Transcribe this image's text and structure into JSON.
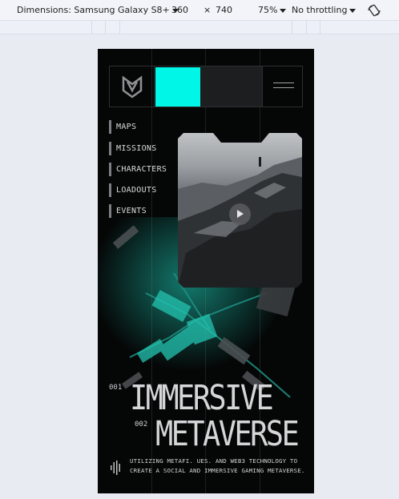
{
  "devtools": {
    "dimensions_label": "Dimensions: Samsung Galaxy S8+",
    "width": "360",
    "times": "×",
    "height": "740",
    "zoom": "75%",
    "throttling": "No throttling",
    "rotate_icon": "rotate-icon"
  },
  "site": {
    "logo_icon": "shield-logo-icon",
    "menu_icon": "hamburger-menu-icon",
    "accent_color": "#00f6e6",
    "nav": [
      "MAPS",
      "MISSIONS",
      "CHARACTERS",
      "LOADOUTS",
      "EVENTS"
    ],
    "video": {
      "play_icon": "play-icon"
    },
    "hero": {
      "num1": "001",
      "line1": "IMMERSIVE",
      "num2": "002",
      "line2": "METAVERSE",
      "description": "UTILIZING METAFI. UES. AND WEB3 TECHNOLOGY TO CREATE A SOCIAL AND IMMERSIVE GAMING METAVERSE.",
      "sound_icon": "sound-wave-icon"
    }
  }
}
